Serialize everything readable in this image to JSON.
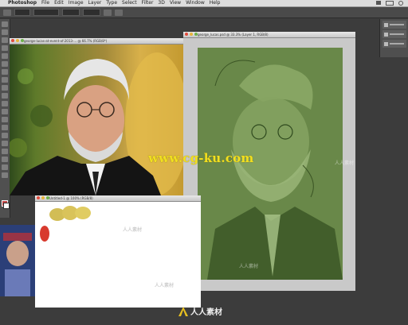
{
  "menubar": {
    "apple_glyph": "",
    "app_name": "Photoshop",
    "items": [
      "File",
      "Edit",
      "Image",
      "Layer",
      "Type",
      "Select",
      "Filter",
      "3D",
      "View",
      "Window",
      "Help"
    ]
  },
  "windows": {
    "photo": {
      "title": "george-lucas-at-event-of-2013-... @ 66.7% (RGB/8*)"
    },
    "sketch": {
      "title": "george_lucas.psd @ 33.3% (Layer 1, RGB/8)"
    },
    "blank": {
      "title": "Untitled-1 @ 100% (RGB/8)"
    }
  },
  "overlay": {
    "watermark": "www.cg-ku.com",
    "logo_text": "人人素材",
    "faint_marks": [
      "人人素材",
      "人人素材",
      "人人素材",
      "人人素材"
    ]
  },
  "colors": {
    "sketch_green": "#6f8f4e",
    "swatch_yellow": "#d9c35a",
    "swatch_red": "#d83a2e",
    "foreground": "#c84848"
  }
}
